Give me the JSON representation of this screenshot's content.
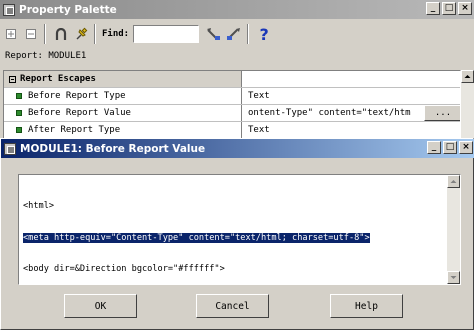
{
  "palette": {
    "title": "Property Palette",
    "window_buttons": [
      "_",
      "□",
      "×"
    ],
    "find_label": "Find:",
    "find_value": "",
    "help_glyph": "?",
    "report_line": "Report: MODULE1",
    "group_label": "Report Escapes",
    "rows": [
      {
        "name": "Before Report Type",
        "value": "Text"
      },
      {
        "name": "Before Report Value",
        "value": "ontent-Type\" content=\"text/htm"
      },
      {
        "name": "After Report Type",
        "value": "Text"
      }
    ],
    "ellipsis_label": "...",
    "icons": [
      "expand-icon",
      "collapse-icon",
      "magnet-icon",
      "pin-icon",
      "find-next-icon",
      "find-prev-icon",
      "help-icon"
    ]
  },
  "dialog": {
    "title": "MODULE1: Before Report Value",
    "window_buttons": [
      "_",
      "□",
      "×"
    ],
    "code_lines": [
      "<html>",
      "<meta http-equiv=\"Content-Type\" content=\"text/html; charset=utf-8\">",
      "<body dir=&Direction bgcolor=\"#ffffff\">"
    ],
    "buttons": {
      "ok": "OK",
      "cancel": "Cancel",
      "help": "Help"
    }
  },
  "colors": {
    "active_title": "#0a246a",
    "inactive_title": "#8a8a8a",
    "selection": "#0a246a",
    "bullet": "#2e8b2e"
  }
}
